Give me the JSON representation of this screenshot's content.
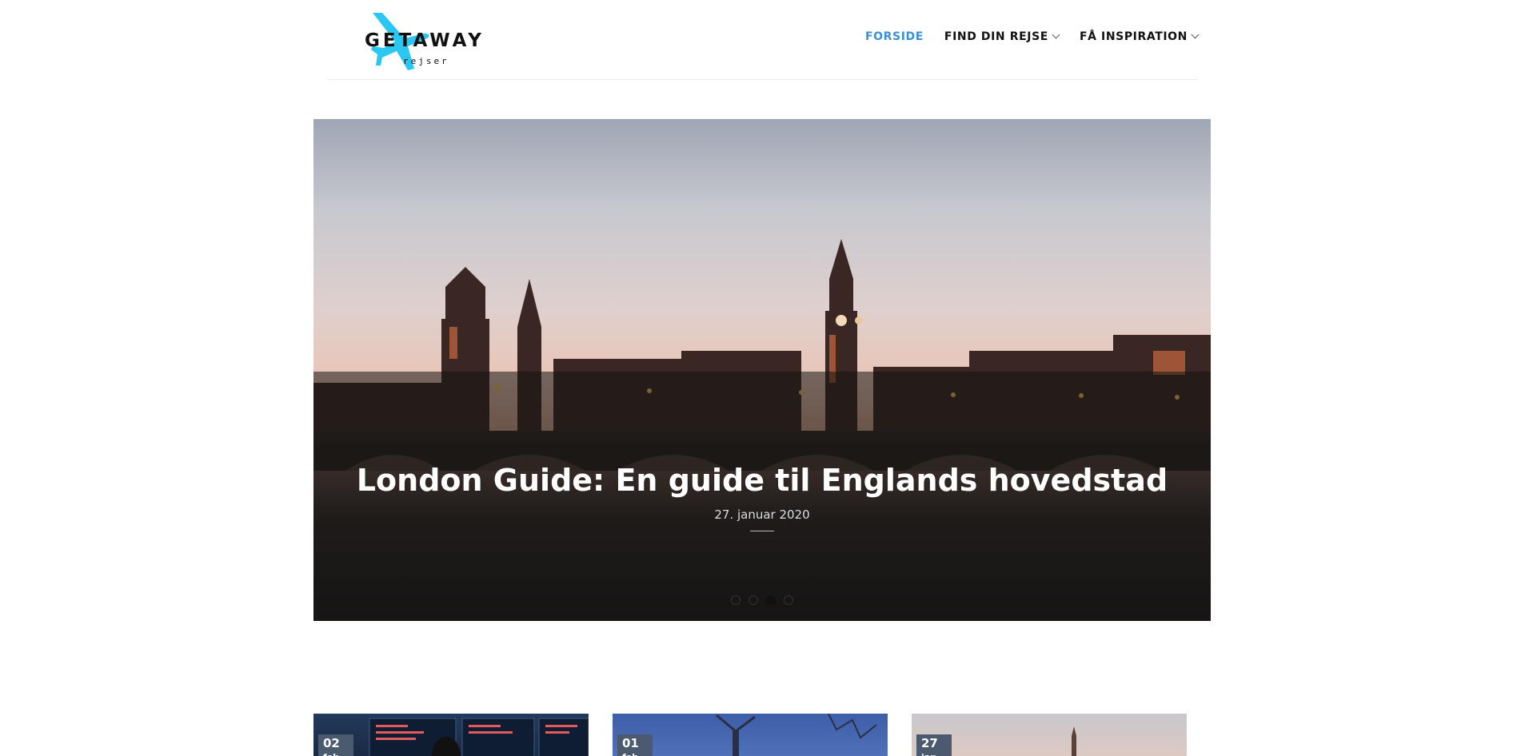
{
  "brand": {
    "logo_word": "GETAWAY",
    "logo_sub": "rejser",
    "accent": "#3b8fd4",
    "plane_color": "#29c7f2"
  },
  "nav": {
    "items": [
      {
        "label": "FORSIDE",
        "active": true,
        "has_dropdown": false
      },
      {
        "label": "FIND DIN REJSE",
        "active": false,
        "has_dropdown": true
      },
      {
        "label": "FÅ INSPIRATION",
        "active": false,
        "has_dropdown": true
      }
    ]
  },
  "hero": {
    "title": "London Guide: En guide til Englands hovedstad",
    "date": "27. januar 2020",
    "slides_count": 4,
    "active_slide": 3
  },
  "cards": [
    {
      "day": "02",
      "month": "feb"
    },
    {
      "day": "01",
      "month": "feb"
    },
    {
      "day": "27",
      "month": "jan"
    }
  ]
}
